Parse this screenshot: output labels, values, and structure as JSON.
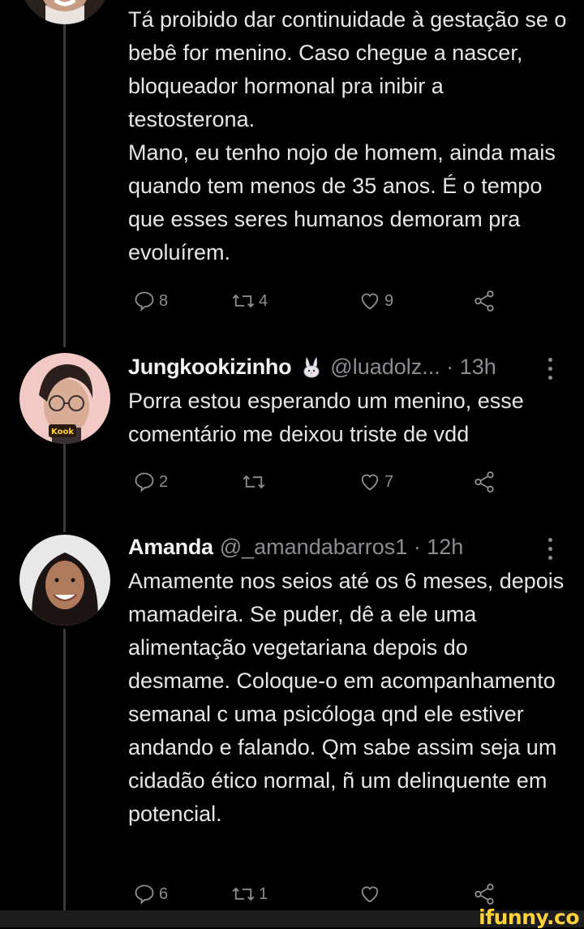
{
  "tweet_top": {
    "text_lines": [
      "Tá proibido dar continuidade à gestação se o bebê for menino. Caso chegue a nascer, bloqueador hormonal pra inibir a testosterona.",
      "Mano, eu tenho nojo de homem, ainda mais quando tem menos de 35 anos. É o tempo que esses seres humanos demoram pra evoluírem."
    ],
    "actions": {
      "reply_count": "8",
      "retweet_count": "4",
      "like_count": "9"
    }
  },
  "tweet_jungkook": {
    "name": "Jungkookizinho",
    "name_emoji": "rabbit-emoji",
    "handle_time": "@luadolz... · 13h",
    "avatar_tag": "Kook",
    "text": "Porra estou esperando um menino, esse comentário me deixou triste de vdd",
    "actions": {
      "reply_count": "2",
      "retweet_count": "",
      "like_count": "7"
    }
  },
  "tweet_amanda": {
    "name": "Amanda",
    "handle_time": "@_amandabarros1 · 12h",
    "text": "Amamente nos seios até os 6 meses, depois mamadeira. Se puder, dê a ele uma alimentação vegetariana depois do desmame. Coloque-o em acompanhamento semanal c uma psicóloga qnd ele estiver andando e falando. Qm sabe assim seja um cidadão ético normal, ñ um delinquente em potencial.",
    "actions": {
      "reply_count": "6",
      "retweet_count": "1",
      "like_count": ""
    }
  },
  "watermark": "ifunny.co",
  "colors": {
    "background": "#000000",
    "text": "#e6e6e6",
    "muted": "#8a8d91",
    "thread_line": "#3a3a3a",
    "watermark": "#ffd23b"
  }
}
